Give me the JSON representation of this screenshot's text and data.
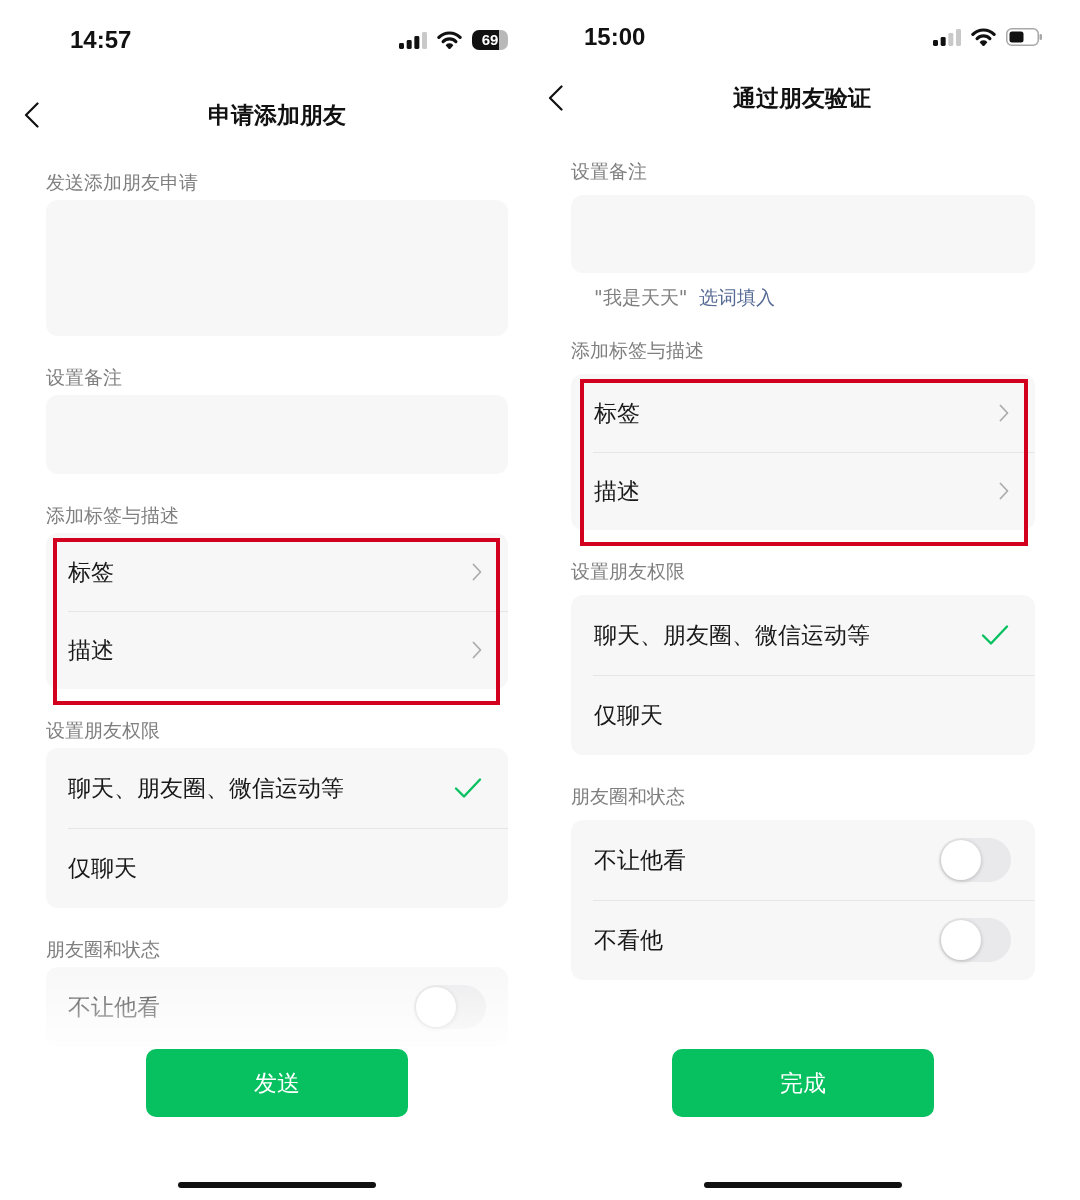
{
  "screens": [
    {
      "status_bar": {
        "time": "14:57",
        "battery_text": "69"
      },
      "nav": {
        "title": "申请添加朋友"
      },
      "sections": [
        {
          "kind": "textarea",
          "label": "发送添加朋友申请",
          "highlighted": false
        },
        {
          "kind": "input",
          "label": "设置备注",
          "highlighted": false
        },
        {
          "kind": "links",
          "label": "添加标签与描述",
          "highlighted": true,
          "items": [
            {
              "label": "标签"
            },
            {
              "label": "描述"
            }
          ]
        },
        {
          "kind": "choices",
          "label": "设置朋友权限",
          "highlighted": false,
          "items": [
            {
              "label": "聊天、朋友圈、微信运动等",
              "selected": true
            },
            {
              "label": "仅聊天",
              "selected": false
            }
          ]
        },
        {
          "kind": "toggles",
          "label": "朋友圈和状态",
          "highlighted": false,
          "items": [
            {
              "label": "不让他看",
              "on": false
            }
          ]
        }
      ],
      "button": {
        "label": "发送"
      }
    },
    {
      "status_bar": {
        "time": "15:00"
      },
      "nav": {
        "title": "通过朋友验证"
      },
      "sections": [
        {
          "kind": "input",
          "label": "设置备注",
          "highlighted": false,
          "hint": "\"我是天天\"",
          "hint_link": "选词填入"
        },
        {
          "kind": "links",
          "label": "添加标签与描述",
          "highlighted": true,
          "items": [
            {
              "label": "标签"
            },
            {
              "label": "描述"
            }
          ]
        },
        {
          "kind": "choices",
          "label": "设置朋友权限",
          "highlighted": false,
          "items": [
            {
              "label": "聊天、朋友圈、微信运动等",
              "selected": true
            },
            {
              "label": "仅聊天",
              "selected": false
            }
          ]
        },
        {
          "kind": "toggles",
          "label": "朋友圈和状态",
          "highlighted": false,
          "items": [
            {
              "label": "不让他看",
              "on": false
            },
            {
              "label": "不看他",
              "on": false
            }
          ]
        }
      ],
      "button": {
        "label": "完成"
      }
    }
  ]
}
